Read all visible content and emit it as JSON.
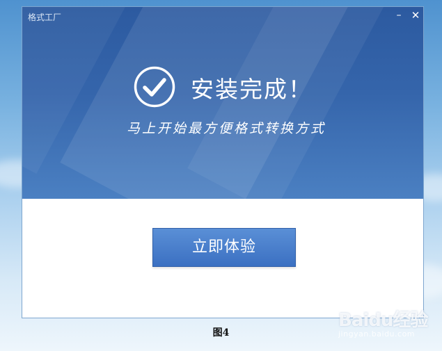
{
  "window": {
    "title": "格式工厂",
    "minimize_glyph": "–",
    "close_glyph": "✕"
  },
  "hero": {
    "icon": "check-circle-icon",
    "heading": "安装完成！",
    "subtitle": "马上开始最方便格式转换方式"
  },
  "action": {
    "button_label": "立即体验",
    "button_color": "#4a7fcc"
  },
  "caption": "图4",
  "watermark": {
    "brand": "Baidu经验",
    "url": "jingyan.baidu.com"
  },
  "colors": {
    "hero_top": "#2c5aa0",
    "hero_bottom": "#4b80c2"
  }
}
